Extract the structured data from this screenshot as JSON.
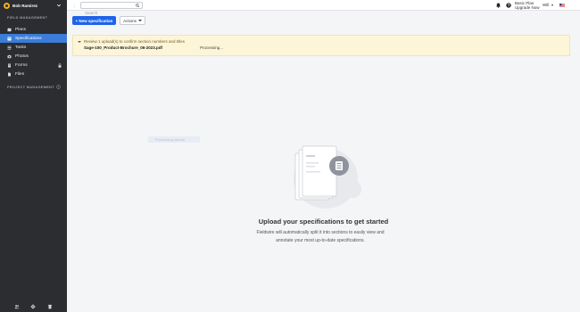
{
  "sidebar": {
    "user_name": "Bob Ramirez",
    "section_field": "FIELD MANAGEMENT",
    "section_project": "PROJECT MANAGEMENT",
    "items": [
      {
        "label": "Plans",
        "icon": "plans-icon"
      },
      {
        "label": "Specifications",
        "icon": "specifications-icon"
      },
      {
        "label": "Tasks",
        "icon": "tasks-icon"
      },
      {
        "label": "Photos",
        "icon": "photos-icon"
      },
      {
        "label": "Forms",
        "icon": "forms-icon"
      },
      {
        "label": "Files",
        "icon": "files-icon"
      }
    ],
    "active_item": "Specifications"
  },
  "topbar": {
    "search_placeholder": "Search",
    "plan_name": "Basic Plan",
    "upgrade_label": "Upgrade Now",
    "user_short": "Will"
  },
  "toolbar": {
    "new_label": "+ New specification",
    "actions_label": "Actions"
  },
  "upload_banner": {
    "review_text": "Review 1 upload(s) to confirm section numbers and titles",
    "file_name": "Sage-100_Product-Brochure_06-2023.pdf",
    "status": "Processing..."
  },
  "ghost_text": "Processing upload",
  "empty_state": {
    "title": "Upload your specifications to get started",
    "description": "Fieldwire will automatically split it into sections to easily view and annotate your most up-to-date specifications."
  },
  "colors": {
    "sidebar_bg": "#2b2d31",
    "active_item": "#3b7dd8",
    "primary_button": "#1e63e9",
    "banner_bg": "#fdf5d8",
    "avatar": "#f3b21a"
  }
}
